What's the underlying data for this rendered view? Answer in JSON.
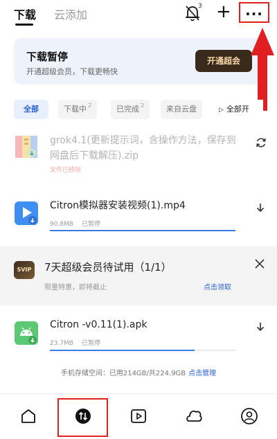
{
  "tabs": {
    "download": "下载",
    "cloud_add": "云添加"
  },
  "header": {
    "bell_badge": "3",
    "add_label": "+",
    "more_label": "···"
  },
  "banner": {
    "title": "下载暂停",
    "subtitle": "开通超级会员，下载更畅快",
    "button": "开通超会"
  },
  "filters": {
    "all": "全部",
    "downloading": "下载中",
    "downloading_count": "2",
    "completed": "已完成",
    "completed_count": "2",
    "from_cloud": "来自云盘",
    "start_all": "全部开"
  },
  "files": [
    {
      "name": "grok4.1(更新提示词，含操作方法，保存到网盘后下载解压).zip",
      "status": "文件已移除",
      "icon": "zip-archive-icon",
      "action": "refresh-icon"
    },
    {
      "name": "Citron模拟器安装视频(1).mp4",
      "size": "90.8MB",
      "state": "已暂停",
      "progress": 1.0,
      "icon": "video-file-icon",
      "action": "download-arrow-icon"
    },
    {
      "name": "Citron -v0.11(1).apk",
      "size": "23.7MB",
      "state": "已暂停",
      "progress": 0.78,
      "icon": "android-apk-icon",
      "action": "download-arrow-icon"
    }
  ],
  "ad": {
    "badge": "SVIP",
    "title": "7天超级会员待试用（1/1）",
    "subtitle": "限量特惠，即将截止",
    "link": "点击领取"
  },
  "storage": {
    "text": "手机存储空间：已用214GB/共224.9GB",
    "link": "点击管理"
  },
  "colors": {
    "accent": "#2a62d8",
    "highlight": "#e02020",
    "vip_button": "#3a2a1b"
  }
}
